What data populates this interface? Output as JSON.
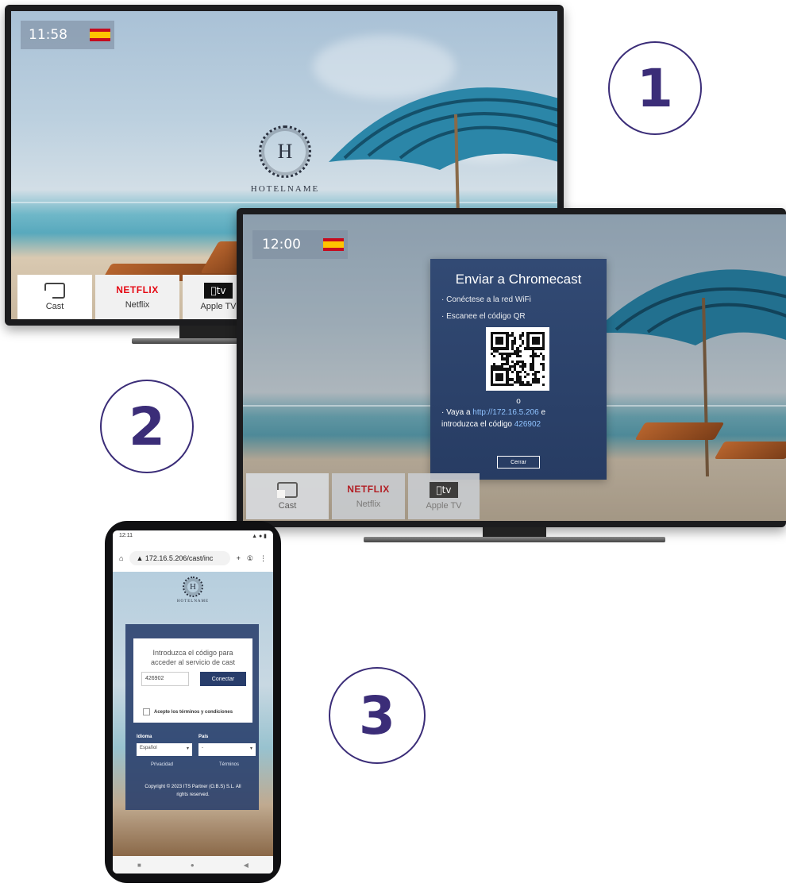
{
  "tv1": {
    "time": "11:58",
    "hotel": {
      "monogram": "H",
      "name": "HOTELNAME"
    },
    "apps": [
      {
        "label": "Cast"
      },
      {
        "label": "Netflix",
        "logo": "NETFLIX"
      },
      {
        "label": "Apple TV",
        "logo": "tv"
      }
    ]
  },
  "tv2": {
    "time": "12:00",
    "dialog": {
      "title": "Enviar a Chromecast",
      "step1": "· Conéctese a la red WiFi",
      "step2": "· Escanee el código QR",
      "or": "o",
      "visit_prefix": "· Vaya a ",
      "url": "http://172.16.5.206",
      "visit_suffix": " e",
      "code_prefix": "introduzca el código ",
      "code": "426902",
      "close_label": "Cerrar"
    },
    "apps": [
      {
        "label": "Cast"
      },
      {
        "label": "Netflix",
        "logo": "NETFLIX"
      },
      {
        "label": "Apple TV",
        "logo": "tv"
      }
    ]
  },
  "steps": [
    "1",
    "2",
    "3"
  ],
  "phone": {
    "status_time": "12:11",
    "url": "172.16.5.206/cast/inc",
    "hotel": {
      "monogram": "H",
      "name": "HOTELNAME"
    },
    "form": {
      "title_line1": "Introduzca el código para",
      "title_line2": "acceder al servicio de cast",
      "code_value": "426902",
      "connect_label": "Conectar",
      "terms_label": "Acepte los términos y condiciones"
    },
    "language_label": "Idioma",
    "language_value": "Español",
    "country_label": "País",
    "country_value": "-",
    "privacy_label": "Privacidad",
    "terms_link": "Términos",
    "copyright_line1": "Copyright © 2023 ITS Partner (O.B.S) S.L. All",
    "copyright_line2": "rights reserved."
  },
  "colors": {
    "accent": "#3b2d78",
    "dialog": "#2e4570",
    "netflix": "#e50914"
  }
}
